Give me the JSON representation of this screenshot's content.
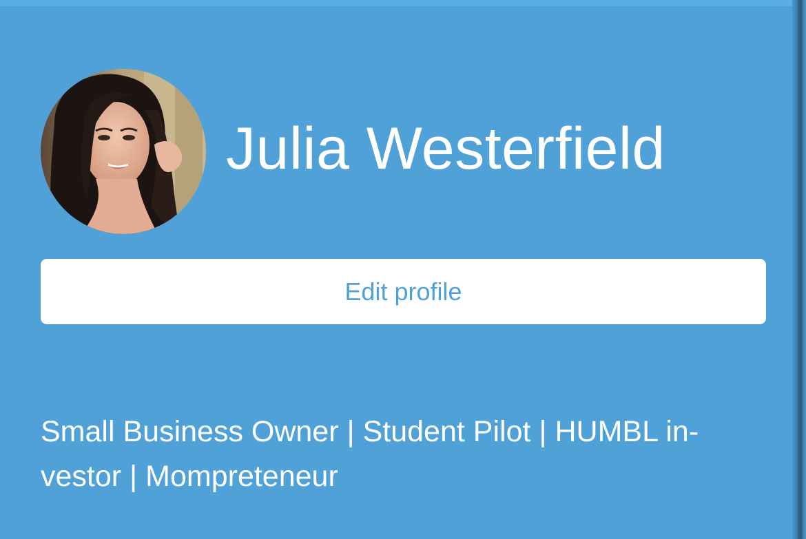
{
  "profile": {
    "name": "Julia Westerfield",
    "edit_label": "Edit profile",
    "bio_lines": [
      "Small Business Owner | Student Pilot | HUMBL in-",
      "vestor | Mompreteneur"
    ]
  },
  "colors": {
    "background": "#4fa1d8",
    "button_background": "#ffffff",
    "button_text": "#4fa1d8",
    "text": "#ffffff"
  },
  "icons": {
    "avatar": "profile-photo"
  }
}
